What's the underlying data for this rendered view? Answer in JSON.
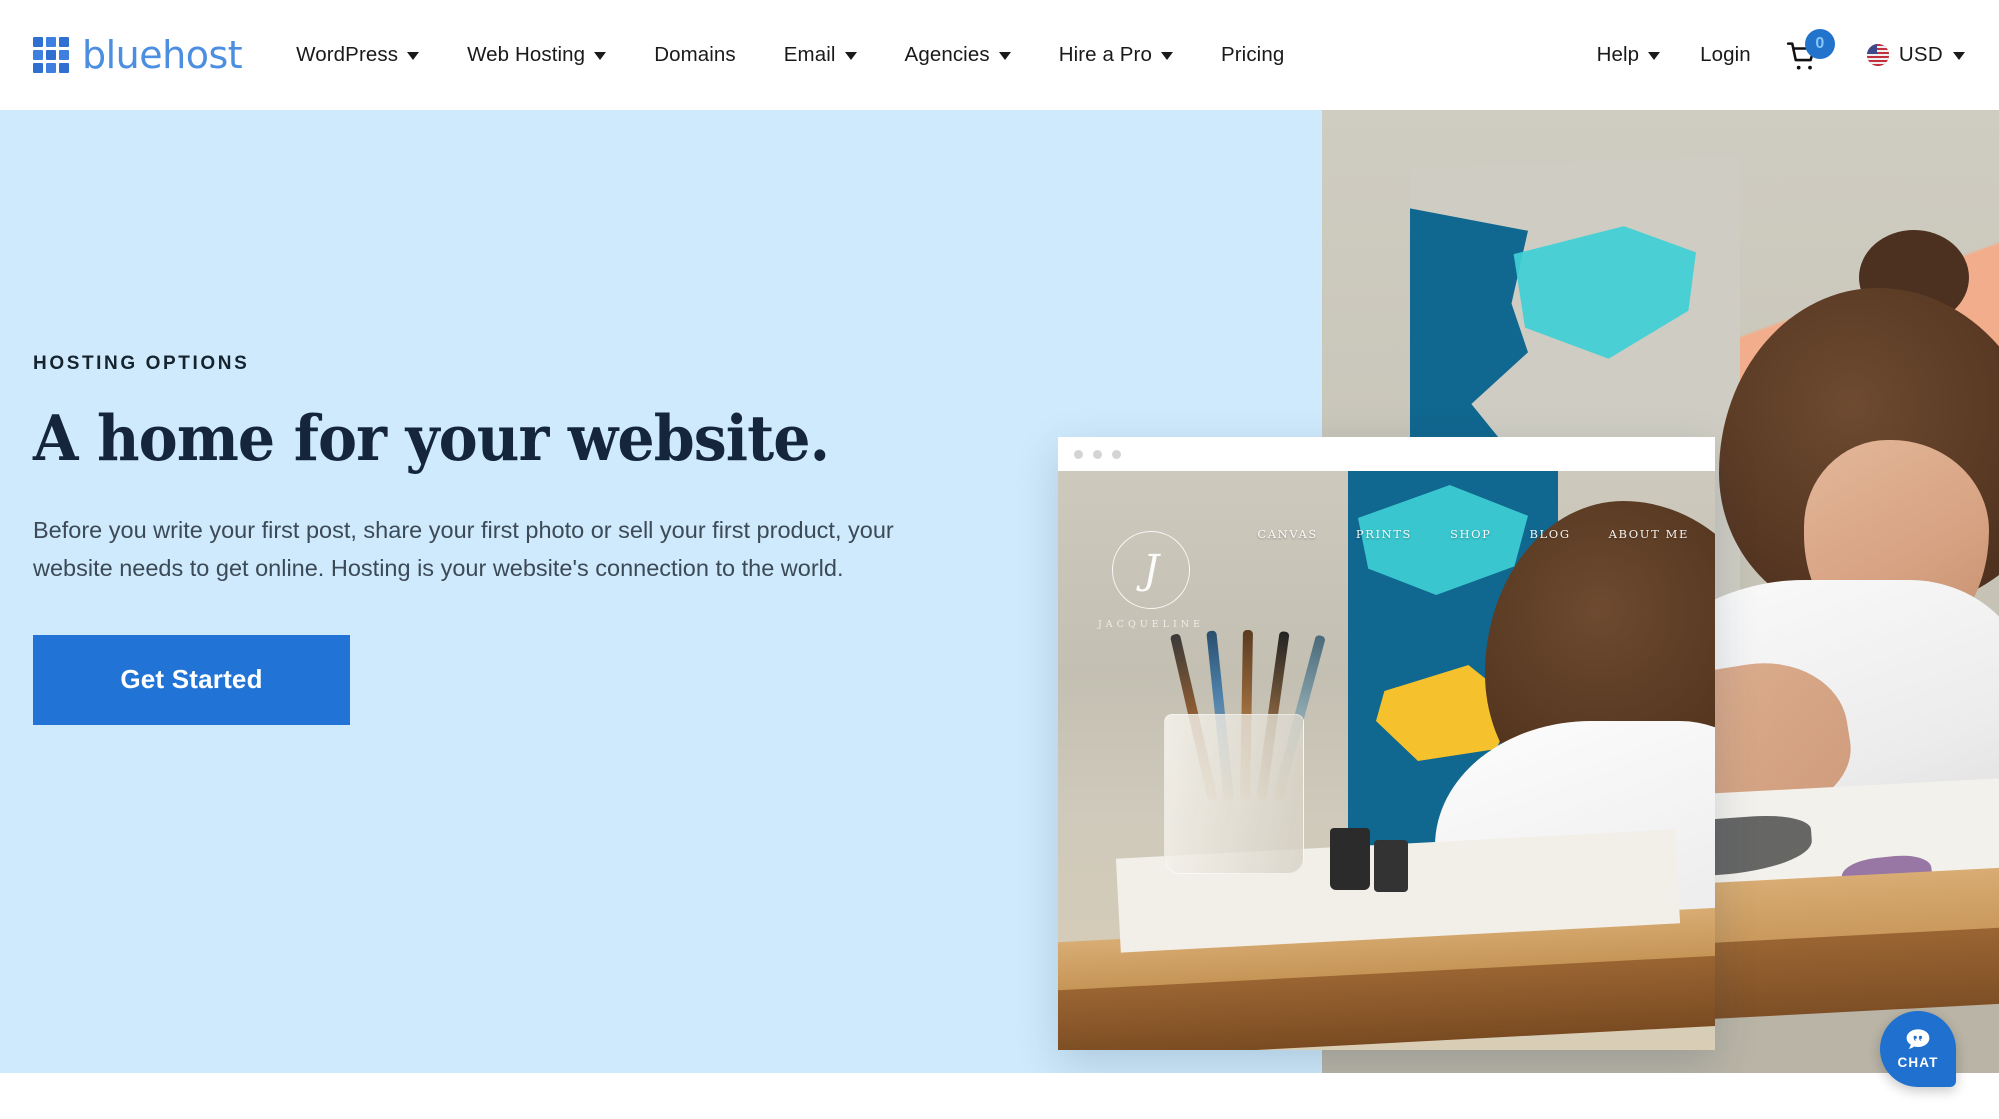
{
  "brand": {
    "name": "bluehost",
    "logo_icon": "grid-logo-icon",
    "logo_colors": [
      "#2f6fd0",
      "#3f7fe0",
      "#2f6fd0",
      "#3f7fe0",
      "#2f6fd0",
      "#3f7fe0",
      "#2f6fd0",
      "#3f7fe0",
      "#2f6fd0"
    ],
    "wordmark_color": "#4c8fe0"
  },
  "header": {
    "nav": [
      {
        "label": "WordPress",
        "has_dropdown": true
      },
      {
        "label": "Web Hosting",
        "has_dropdown": true
      },
      {
        "label": "Domains",
        "has_dropdown": false
      },
      {
        "label": "Email",
        "has_dropdown": true
      },
      {
        "label": "Agencies",
        "has_dropdown": true
      },
      {
        "label": "Hire a Pro",
        "has_dropdown": true
      },
      {
        "label": "Pricing",
        "has_dropdown": false
      }
    ],
    "help": {
      "label": "Help",
      "has_dropdown": true
    },
    "login": {
      "label": "Login"
    },
    "cart": {
      "icon": "shopping-cart-icon",
      "count": "0",
      "badge_color": "#2273cc"
    },
    "currency": {
      "label": "USD",
      "flag": "us-flag-icon",
      "has_dropdown": true
    }
  },
  "hero": {
    "eyebrow": "HOSTING OPTIONS",
    "headline": "A home for your website.",
    "body": "Before you write your first post, share your first photo or sell your first product, your website needs to get online. Hosting is your website's connection to the world.",
    "cta_label": "Get Started",
    "background_color": "#cfeafc",
    "cta_color": "#2173d6",
    "headline_color": "#15263c"
  },
  "mockup": {
    "window_dots": 3,
    "brand_monogram": "J",
    "brand_name": "JACQUELINE",
    "nav": [
      "CANVAS",
      "PRINTS",
      "SHOP",
      "BLOG",
      "ABOUT ME"
    ]
  },
  "chat": {
    "label": "CHAT",
    "icon": "chat-bubble-icon",
    "color": "#2070cf"
  }
}
